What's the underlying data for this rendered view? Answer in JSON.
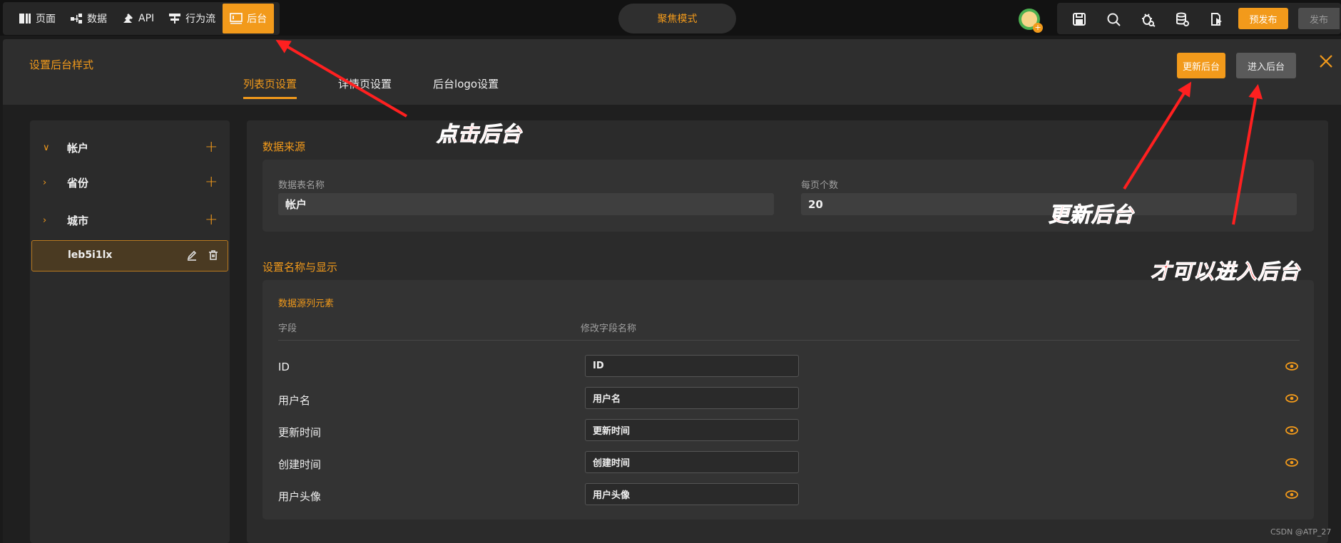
{
  "topbar": {
    "nav": [
      {
        "label": "页面",
        "icon": "page-icon"
      },
      {
        "label": "数据",
        "icon": "data-icon"
      },
      {
        "label": "API",
        "icon": "api-icon"
      },
      {
        "label": "行为流",
        "icon": "flow-icon"
      },
      {
        "label": "后台",
        "icon": "admin-icon",
        "active": true
      }
    ],
    "focus_mode": "聚焦模式",
    "tools": [
      "save-icon",
      "search-icon",
      "debug-icon",
      "database-icon",
      "export-icon"
    ],
    "prepublish": "预发布",
    "publish": "发布"
  },
  "panel": {
    "title": "设置后台样式",
    "tabs": [
      "列表页设置",
      "详情页设置",
      "后台logo设置"
    ],
    "active_tab": 0,
    "update_button": "更新后台",
    "enter_button": "进入后台"
  },
  "sidebar": {
    "items": [
      {
        "label": "帐户",
        "expanded": true
      },
      {
        "label": "leb5i1lx",
        "selected": true
      },
      {
        "label": "省份",
        "expanded": false
      },
      {
        "label": "城市",
        "expanded": false
      }
    ]
  },
  "main": {
    "datasource": {
      "title": "数据来源",
      "table_label": "数据表名称",
      "table_value": "帐户",
      "perpage_label": "每页个数",
      "perpage_value": "20"
    },
    "display": {
      "title": "设置名称与显示",
      "subtitle": "数据源列元素",
      "col_field": "字段",
      "col_rename": "修改字段名称",
      "rows": [
        {
          "field": "ID",
          "value": "ID"
        },
        {
          "field": "用户名",
          "value": "用户名"
        },
        {
          "field": "更新时间",
          "value": "更新时间"
        },
        {
          "field": "创建时间",
          "value": "创建时间"
        },
        {
          "field": "用户头像",
          "value": "用户头像"
        }
      ]
    }
  },
  "annotations": {
    "click_admin": "点击后台",
    "update_admin": "更新后台",
    "then_enter": "才可以进入后台"
  },
  "watermark": "CSDN @ATP_27",
  "colors": {
    "accent": "#f29a1b",
    "annotation": "#ff2a2a"
  }
}
